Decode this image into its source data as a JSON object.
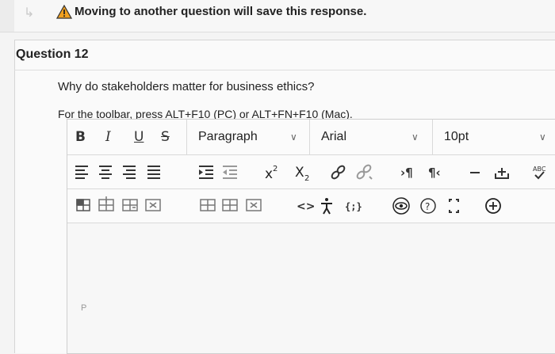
{
  "notice": {
    "text": "Moving to another question will save this response.",
    "warning_color": "#e8a317"
  },
  "question": {
    "title": "Question 12",
    "prompt": "Why do stakeholders matter for business ethics?",
    "toolbar_hint": "For the toolbar, press ALT+F10 (PC) or ALT+FN+F10 (Mac)."
  },
  "toolbar": {
    "bold": "B",
    "italic": "I",
    "underline": "U",
    "strike": "S",
    "paragraph": "Paragraph",
    "font": "Arial",
    "size": "10pt",
    "spellcheck": "ABC"
  },
  "editor": {
    "path": "P"
  }
}
